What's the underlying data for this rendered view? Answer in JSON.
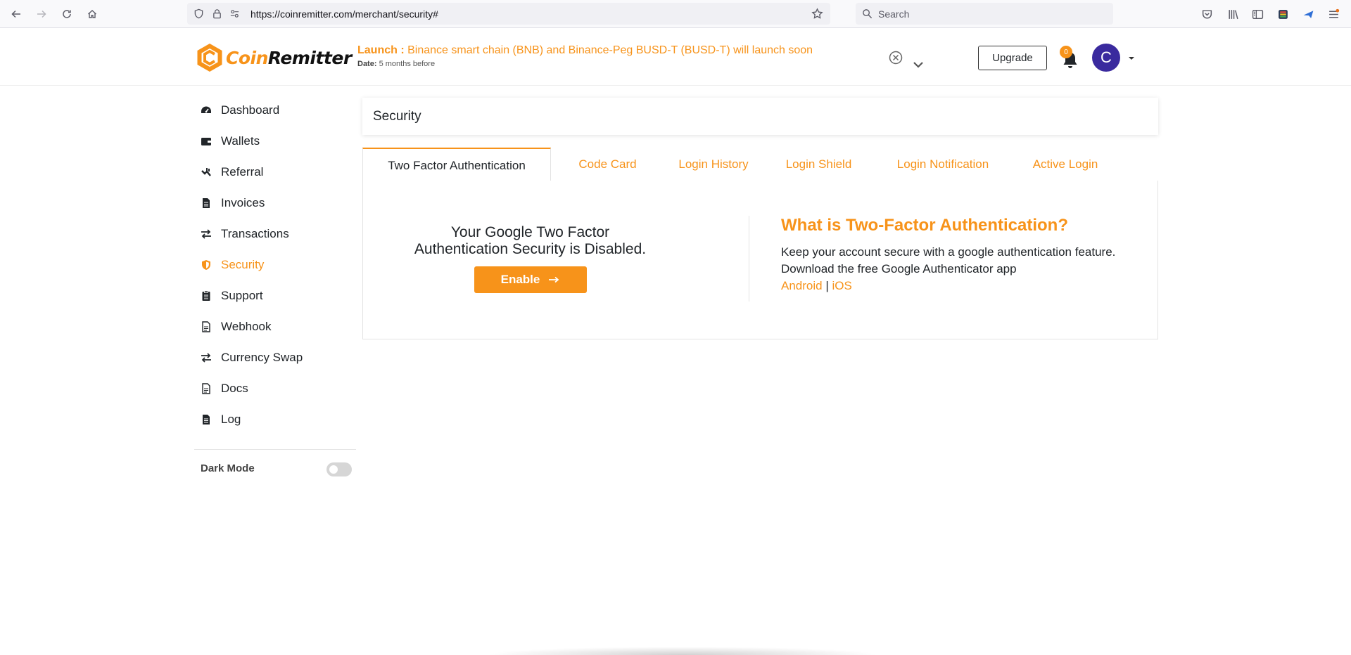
{
  "browser": {
    "url": "https://coinremitter.com/merchant/security#",
    "search_placeholder": "Search"
  },
  "header": {
    "logo": {
      "part1": "Coin",
      "part2": "Remitter"
    },
    "announcement": {
      "prefix": "Launch :",
      "text": "Binance smart chain (BNB) and Binance-Peg BUSD-T (BUSD-T) will launch soon",
      "date_label": "Date:",
      "date_value": "5 months before"
    },
    "upgrade_label": "Upgrade",
    "notification_count": "0",
    "avatar_initial": "C"
  },
  "sidebar": {
    "items": [
      {
        "label": "Dashboard",
        "icon": "dashboard-icon"
      },
      {
        "label": "Wallets",
        "icon": "wallet-icon"
      },
      {
        "label": "Referral",
        "icon": "referral-icon"
      },
      {
        "label": "Invoices",
        "icon": "invoice-icon"
      },
      {
        "label": "Transactions",
        "icon": "transactions-icon"
      },
      {
        "label": "Security",
        "icon": "shield-icon",
        "active": true
      },
      {
        "label": "Support",
        "icon": "support-icon"
      },
      {
        "label": "Webhook",
        "icon": "webhook-icon"
      },
      {
        "label": "Currency Swap",
        "icon": "swap-icon"
      },
      {
        "label": "Docs",
        "icon": "docs-icon"
      },
      {
        "label": "Log",
        "icon": "log-icon"
      }
    ],
    "dark_mode_label": "Dark Mode",
    "dark_mode_on": false
  },
  "main": {
    "page_title": "Security",
    "tabs": [
      {
        "label": "Two Factor Authentication",
        "active": true
      },
      {
        "label": "Code Card"
      },
      {
        "label": "Login History"
      },
      {
        "label": "Login Shield"
      },
      {
        "label": "Login Notification"
      },
      {
        "label": "Active Login"
      }
    ],
    "status_text": "Your Google Two Factor Authentication Security is Disabled.",
    "enable_label": "Enable",
    "info_title": "What is Two-Factor Authentication?",
    "info_text": "Keep your account secure with a google authentication feature. Download the free Google Authenticator app",
    "links": {
      "android": "Android",
      "separator": "|",
      "ios": "iOS"
    }
  },
  "colors": {
    "accent": "#f7931a",
    "avatar_bg": "#3a2a9e",
    "text": "#212529"
  }
}
